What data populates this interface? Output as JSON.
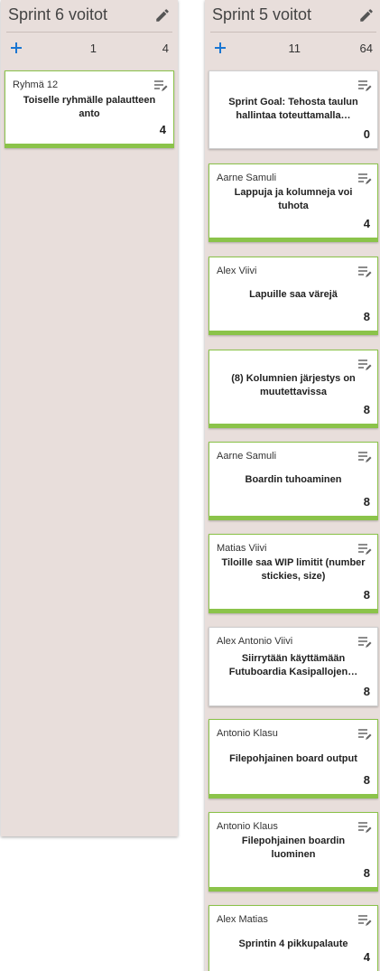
{
  "columns": [
    {
      "title": "Sprint 6 voitot",
      "count": "1",
      "sum": "4",
      "cards": [
        {
          "assignee": "Ryhmä 12",
          "text": "Toiselle ryhmälle palautteen anto",
          "points": "4",
          "green": true
        }
      ]
    },
    {
      "title": "Sprint 5 voitot",
      "count": "11",
      "sum": "64",
      "cards": [
        {
          "assignee": "",
          "text": "Sprint Goal: Tehosta taulun hallintaa toteuttamalla…",
          "points": "0",
          "green": false
        },
        {
          "assignee": "Aarne Samuli",
          "text": "Lappuja ja kolumneja voi tuhota",
          "points": "4",
          "green": true
        },
        {
          "assignee": "Alex Viivi",
          "text": "Lapuille saa värejä",
          "points": "8",
          "green": true
        },
        {
          "assignee": "",
          "text": "(8) Kolumnien järjestys on muutettavissa",
          "points": "8",
          "green": true
        },
        {
          "assignee": "Aarne Samuli",
          "text": "Boardin tuhoaminen",
          "points": "8",
          "green": true
        },
        {
          "assignee": "Matias Viivi",
          "text": "Tiloille saa WIP limitit (number stickies, size)",
          "points": "8",
          "green": true
        },
        {
          "assignee": "Alex Antonio Viivi",
          "text": "Siirrytään käyttämään Futuboardia Kasipallojen…",
          "points": "8",
          "green": false
        },
        {
          "assignee": "Antonio Klasu",
          "text": "Filepohjainen board output",
          "points": "8",
          "green": true
        },
        {
          "assignee": "Antonio Klaus",
          "text": "Filepohjainen boardin luominen",
          "points": "8",
          "green": true
        },
        {
          "assignee": "Alex Matias",
          "text": "Sprintin 4 pikkupalaute",
          "points": "4",
          "green": true
        }
      ]
    }
  ],
  "icons": {
    "edit": "pencil-icon",
    "add": "plus-icon",
    "card_menu": "edit-note-icon"
  },
  "colors": {
    "column_bg": "#e8dedb",
    "accent_green": "#8bc34a",
    "add_blue": "#1976d2"
  }
}
